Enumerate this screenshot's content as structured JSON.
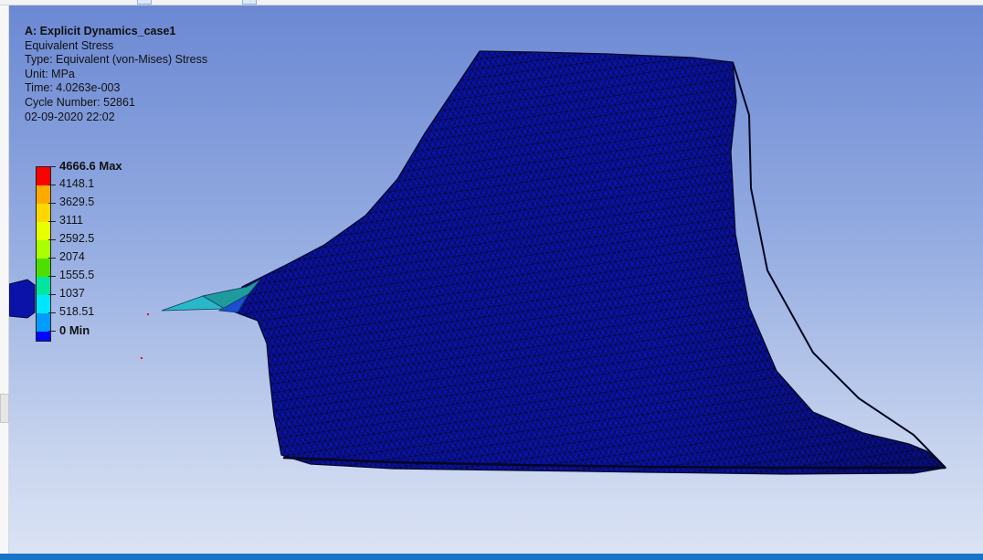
{
  "info": {
    "title": "A: Explicit Dynamics_case1",
    "result": "Equivalent Stress",
    "type": "Type: Equivalent (von-Mises) Stress",
    "unit": "Unit: MPa",
    "time": "Time: 4.0263e-003",
    "cycle": "Cycle Number: 52861",
    "date": "02-09-2020 22:02"
  },
  "legend": {
    "labels": [
      "4666.6 Max",
      "4148.1",
      "3629.5",
      "3111",
      "2592.5",
      "2074",
      "1555.5",
      "1037",
      "518.51",
      "0 Min"
    ],
    "colors": [
      "#ff0000",
      "#ffaa00",
      "#ffd700",
      "#e8ff00",
      "#aaff00",
      "#4ede00",
      "#00e6a0",
      "#00e6ff",
      "#009cff",
      "#0008ff"
    ]
  },
  "colors": {
    "mesh_fill": "#0a12a8",
    "mesh_line": "#050a40",
    "fringe_cyan": "#29b8c8",
    "fringe_teal": "#1f9b9e",
    "status_bar": "#1874c9"
  }
}
